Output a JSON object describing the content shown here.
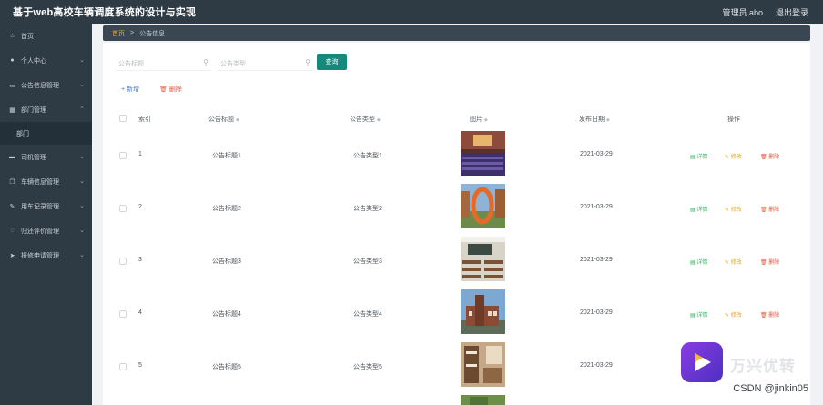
{
  "header": {
    "title": "基于web高校车辆调度系统的设计与实现",
    "user_label": "管理员 abo",
    "logout_label": "退出登录"
  },
  "sidebar": {
    "items": [
      {
        "label": "首页",
        "icon": "home-icon"
      },
      {
        "label": "个人中心",
        "icon": "user-icon"
      },
      {
        "label": "公告信息管理",
        "icon": "message-icon"
      },
      {
        "label": "部门管理",
        "icon": "building-icon",
        "expanded": true,
        "children": [
          "部门"
        ]
      },
      {
        "label": "司机管理",
        "icon": "car-icon"
      },
      {
        "label": "车辆信息管理",
        "icon": "copy-icon"
      },
      {
        "label": "用车记录管理",
        "icon": "edit-icon"
      },
      {
        "label": "归还评价管理",
        "icon": "chat-icon"
      },
      {
        "label": "报修申请管理",
        "icon": "send-icon"
      }
    ]
  },
  "breadcrumb": {
    "home": "首页",
    "separator": ">",
    "current": "公告信息"
  },
  "search": {
    "title_placeholder": "公告标题",
    "type_placeholder": "公告类型",
    "query_label": "查询"
  },
  "toolbar": {
    "add_label": "+ 新增",
    "delete_label": "删除"
  },
  "table": {
    "headers": [
      "索引",
      "公告标题",
      "公告类型",
      "图片",
      "发布日期",
      "操作"
    ],
    "rows": [
      {
        "index": "1",
        "title": "公告标题1",
        "type": "公告类型1",
        "date": "2021-03-29",
        "image": "auditorium"
      },
      {
        "index": "2",
        "title": "公告标题2",
        "type": "公告类型2",
        "date": "2021-03-29",
        "image": "sculpture"
      },
      {
        "index": "3",
        "title": "公告标题3",
        "type": "公告类型3",
        "date": "2021-03-29",
        "image": "classroom"
      },
      {
        "index": "4",
        "title": "公告标题4",
        "type": "公告类型4",
        "date": "2021-03-29",
        "image": "building"
      },
      {
        "index": "5",
        "title": "公告标题5",
        "type": "公告类型5",
        "date": "2021-03-29",
        "image": "dorm"
      }
    ],
    "actions": {
      "view": "详情",
      "edit": "修改",
      "delete": "删除"
    }
  },
  "watermark": {
    "text": "万兴优转",
    "credit": "CSDN @jinkin05"
  },
  "colors": {
    "sidebar_bg": "#2e3a44",
    "accent": "#16897d",
    "breadcrumb_home": "#f0a64a"
  }
}
